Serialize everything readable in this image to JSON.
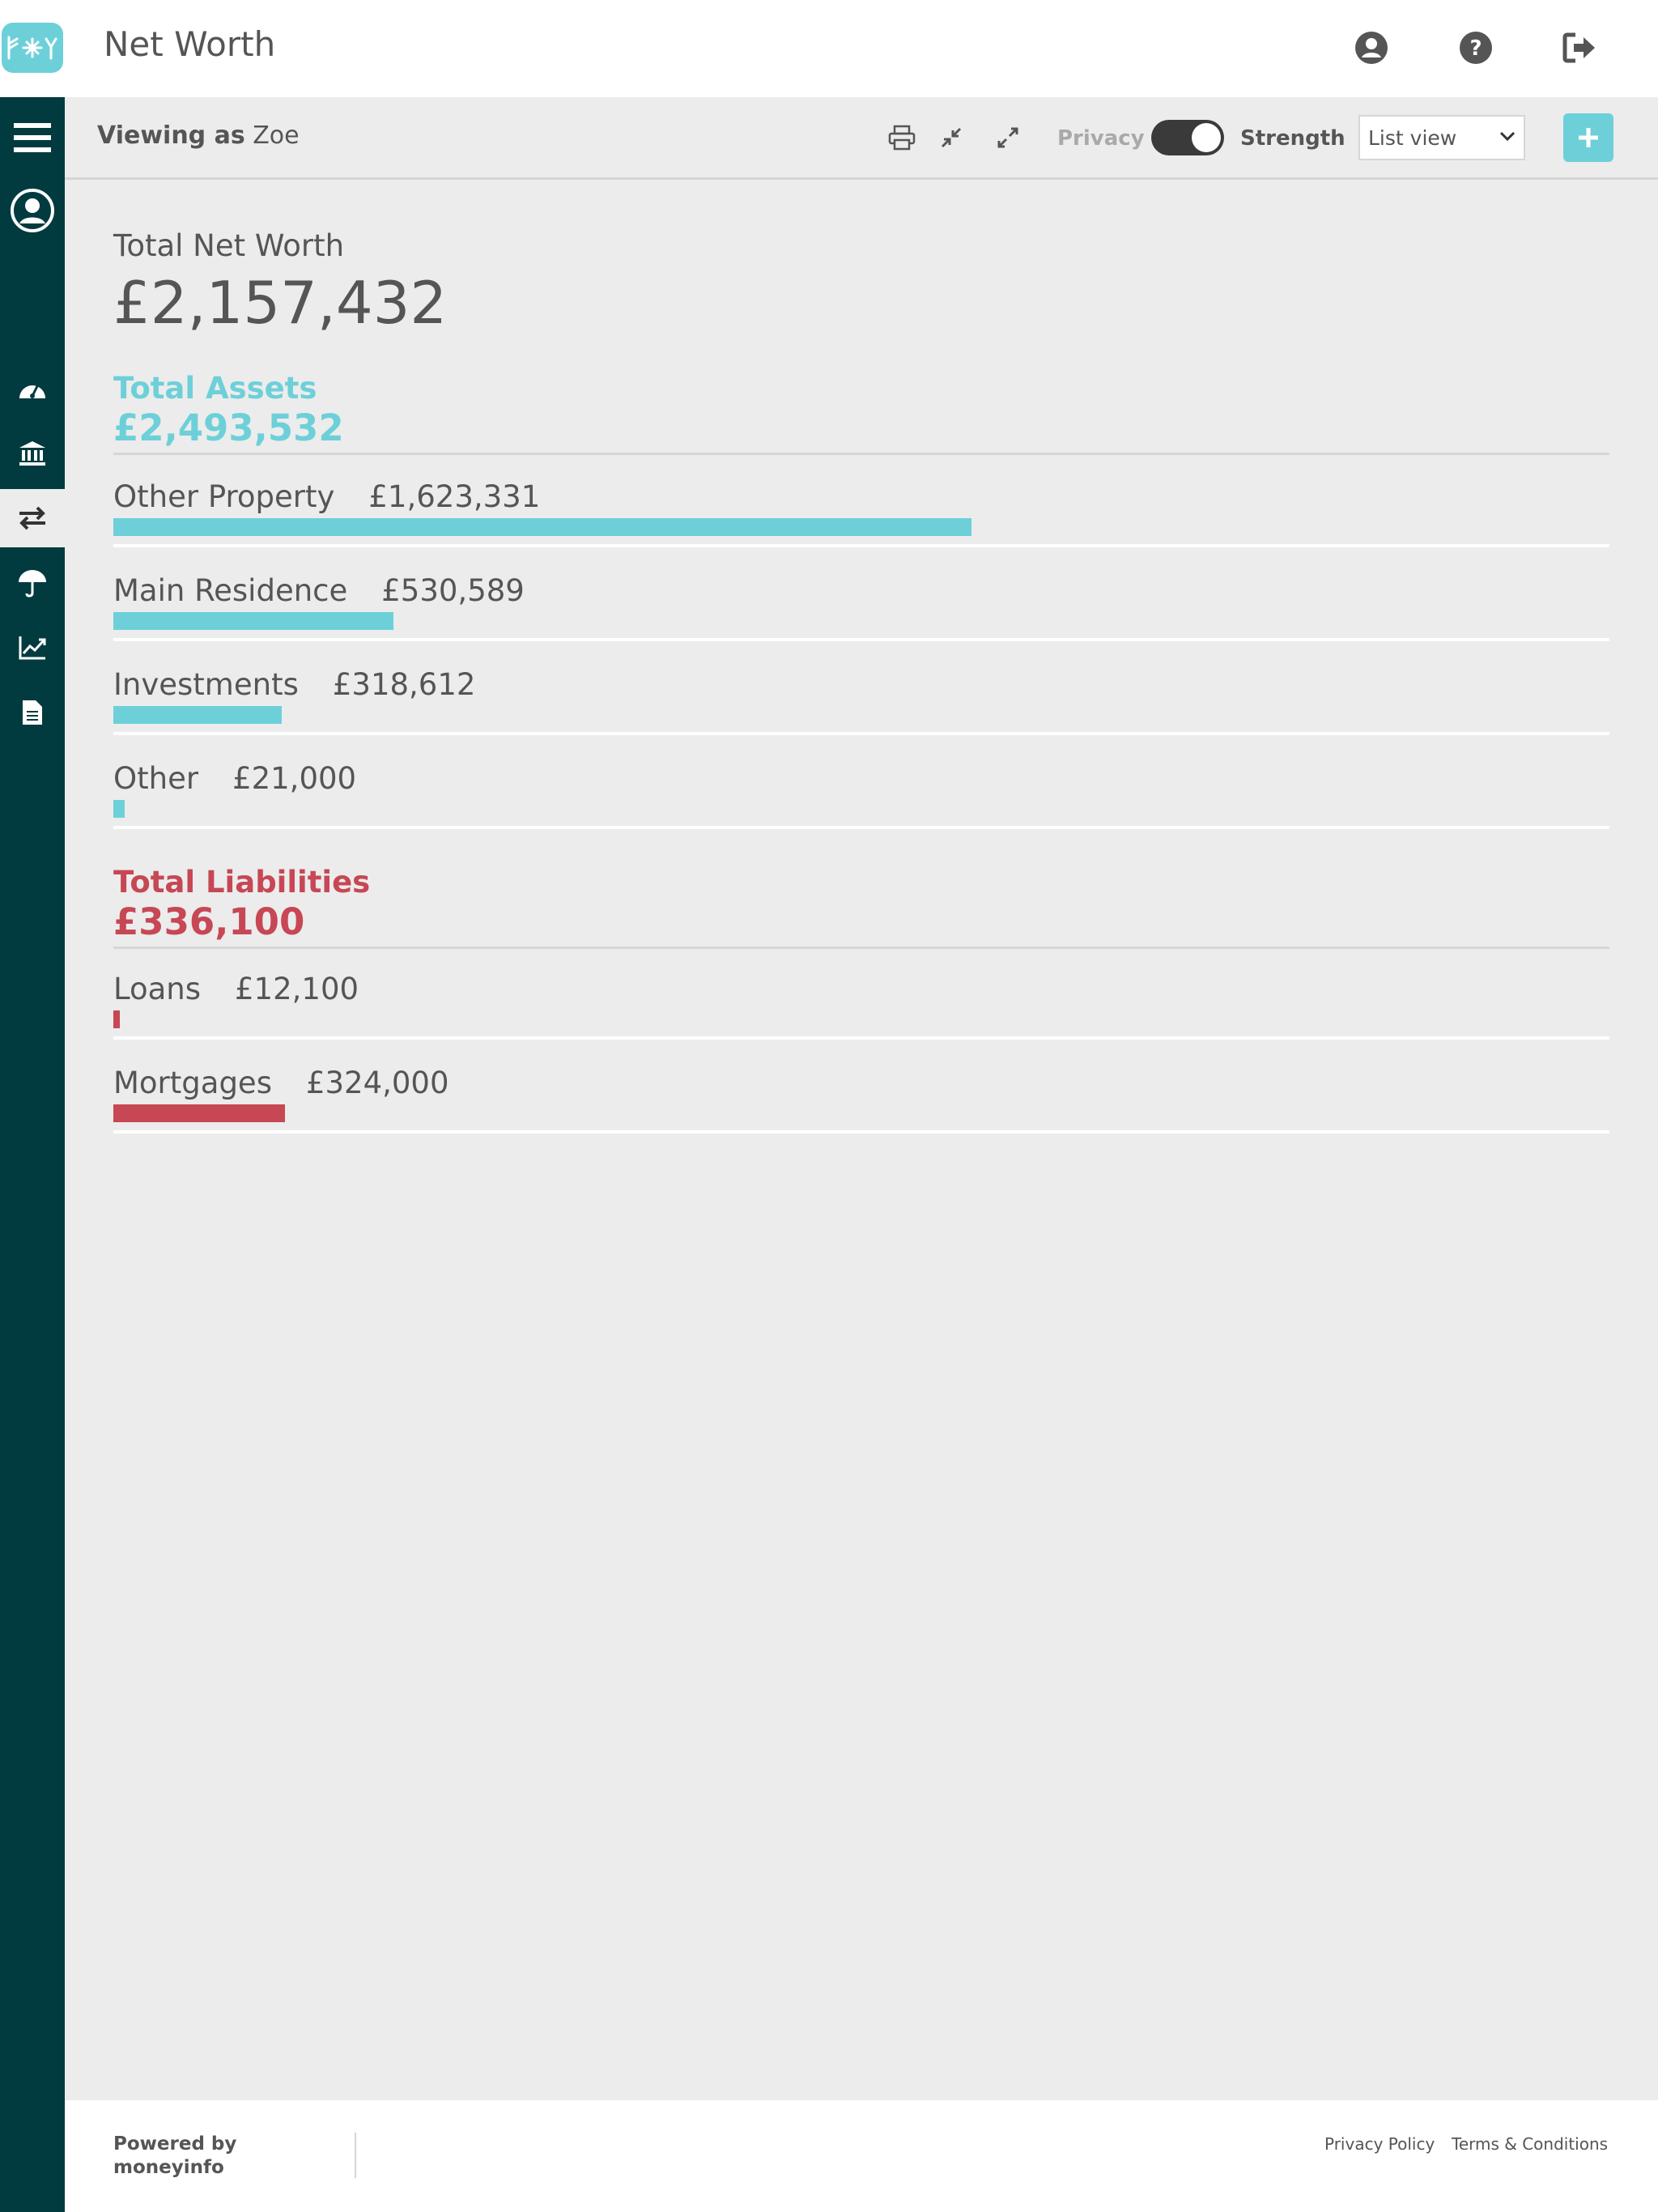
{
  "header": {
    "logo_text": "ꝀꝊY",
    "title": "Net Worth",
    "icons": [
      "user-circle-icon",
      "question-circle-icon",
      "sign-out-icon"
    ]
  },
  "sidebar": {
    "items": [
      {
        "name": "menu",
        "icon": "hamburger-icon"
      },
      {
        "name": "profile",
        "icon": "user-circle-icon"
      },
      {
        "name": "dashboard",
        "icon": "gauge-icon"
      },
      {
        "name": "accounts",
        "icon": "bank-icon"
      },
      {
        "name": "net-worth",
        "icon": "transfer-arrows-icon",
        "active": true
      },
      {
        "name": "protection",
        "icon": "umbrella-icon"
      },
      {
        "name": "investments",
        "icon": "chart-line-icon"
      },
      {
        "name": "documents",
        "icon": "document-icon"
      }
    ]
  },
  "toolbar": {
    "viewing_as_label": "Viewing as",
    "viewing_as_name": "Zoe",
    "privacy_label": "Privacy",
    "privacy_on": true,
    "strength_label": "Strength",
    "view_select": "List view",
    "icons": [
      "print-icon",
      "compress-icon",
      "expand-icon",
      "plus-icon"
    ]
  },
  "summary": {
    "net_worth_label": "Total Net Worth",
    "net_worth_value": "£2,157,432"
  },
  "assets": {
    "title": "Total Assets",
    "total": "£2,493,532",
    "color": "#6dd0d9",
    "rows": [
      {
        "label": "Other Property",
        "amount": "£1,623,331",
        "value": 1623331
      },
      {
        "label": "Main Residence",
        "amount": "£530,589",
        "value": 530589
      },
      {
        "label": "Investments",
        "amount": "£318,612",
        "value": 318612
      },
      {
        "label": "Other",
        "amount": "£21,000",
        "value": 21000
      }
    ]
  },
  "liabilities": {
    "title": "Total Liabilities",
    "total": "£336,100",
    "color": "#c74755",
    "rows": [
      {
        "label": "Loans",
        "amount": "£12,100",
        "value": 12100
      },
      {
        "label": "Mortgages",
        "amount": "£324,000",
        "value": 324000
      }
    ]
  },
  "footer": {
    "powered_line1": "Powered by",
    "powered_line2": "moneyinfo",
    "privacy_link": "Privacy Policy",
    "terms_link": "Terms & Conditions"
  }
}
